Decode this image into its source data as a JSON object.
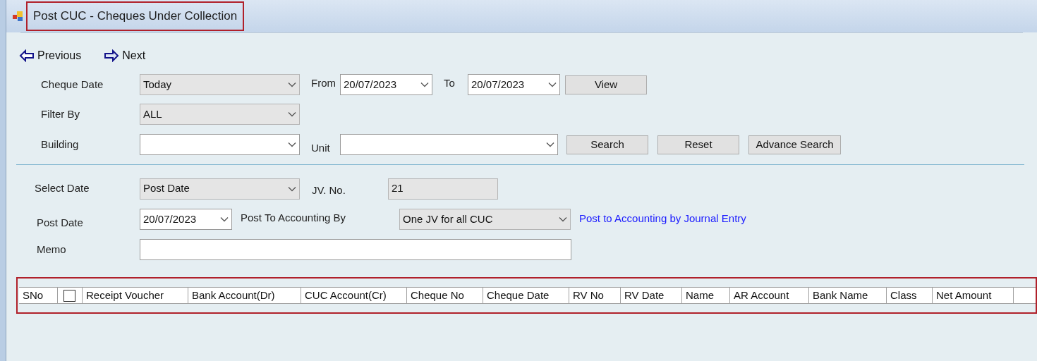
{
  "window": {
    "title": "Post CUC - Cheques Under Collection",
    "highlighted": true
  },
  "toolbar": [
    {
      "kind": "previous",
      "label": "Previous"
    },
    {
      "kind": "next",
      "label": "Next"
    }
  ],
  "filters": {
    "cheque_date": {
      "label": "Cheque Date",
      "value": "Today",
      "kind": "list"
    },
    "from": {
      "label": "From",
      "value": "20/07/2023",
      "kind": "date"
    },
    "to": {
      "label": "To",
      "value": "20/07/2023",
      "kind": "date"
    },
    "view_button": "View",
    "filter_by": {
      "label": "Filter By",
      "value": "ALL",
      "kind": "list"
    },
    "building": {
      "label": "Building",
      "kind": "combo"
    },
    "unit": {
      "label": "Unit",
      "kind": "combo"
    },
    "buttons": [
      "Search",
      "Reset",
      "Advance Search"
    ]
  },
  "posting": {
    "select_date": {
      "label": "Select Date",
      "value": "Post Date",
      "kind": "list"
    },
    "jv_no": {
      "label": "JV. No.",
      "value": "21",
      "kind": "readonly"
    },
    "post_date": {
      "label": "Post Date",
      "value": "20/07/2023",
      "kind": "date"
    },
    "post_to_accounting_by": {
      "label": "Post To Accounting By",
      "value": "One JV for all CUC",
      "kind": "list"
    },
    "link": "Post to Accounting by Journal Entry",
    "memo": {
      "label": "Memo",
      "kind": "text"
    }
  },
  "table": {
    "highlighted": true,
    "select_all_checked": false,
    "columns": [
      {
        "label": "SNo",
        "kind": "text"
      },
      {
        "kind": "checkbox"
      },
      {
        "label": "Receipt Voucher",
        "kind": "text"
      },
      {
        "label": "Bank Account(Dr)",
        "kind": "text"
      },
      {
        "label": "CUC Account(Cr)",
        "kind": "text"
      },
      {
        "label": "Cheque No",
        "kind": "text"
      },
      {
        "label": "Cheque Date",
        "kind": "text"
      },
      {
        "label": "RV No",
        "kind": "text"
      },
      {
        "label": "RV Date",
        "kind": "text"
      },
      {
        "label": "Name",
        "kind": "text"
      },
      {
        "label": "AR Account",
        "kind": "text"
      },
      {
        "label": "Bank Name",
        "kind": "text"
      },
      {
        "label": "Class",
        "kind": "text"
      },
      {
        "label": "Net Amount",
        "kind": "text"
      }
    ]
  }
}
